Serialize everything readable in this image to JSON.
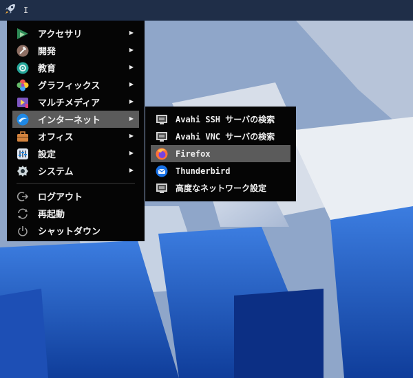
{
  "panel": {
    "launcher_icon": "rocket-icon",
    "text": "I"
  },
  "menu": {
    "items": [
      {
        "label": "アクセサリ",
        "icon": "accessories-icon",
        "has_submenu": true
      },
      {
        "label": "開発",
        "icon": "development-icon",
        "has_submenu": true
      },
      {
        "label": "教育",
        "icon": "education-icon",
        "has_submenu": true
      },
      {
        "label": "グラフィックス",
        "icon": "graphics-icon",
        "has_submenu": true
      },
      {
        "label": "マルチメディア",
        "icon": "multimedia-icon",
        "has_submenu": true
      },
      {
        "label": "インターネット",
        "icon": "internet-icon",
        "has_submenu": true,
        "active": true
      },
      {
        "label": "オフィス",
        "icon": "office-icon",
        "has_submenu": true
      },
      {
        "label": "設定",
        "icon": "settings-icon",
        "has_submenu": true
      },
      {
        "label": "システム",
        "icon": "system-icon",
        "has_submenu": true
      }
    ],
    "session": [
      {
        "label": "ログアウト",
        "icon": "logout-icon"
      },
      {
        "label": "再起動",
        "icon": "restart-icon"
      },
      {
        "label": "シャットダウン",
        "icon": "shutdown-icon"
      }
    ]
  },
  "submenu": {
    "items": [
      {
        "label": "Avahi SSH サーバの検索",
        "icon": "network-icon"
      },
      {
        "label": "Avahi VNC サーバの検索",
        "icon": "network-icon"
      },
      {
        "label": "Firefox",
        "icon": "firefox-icon",
        "active": true
      },
      {
        "label": "Thunderbird",
        "icon": "thunderbird-icon"
      },
      {
        "label": "高度なネットワーク設定",
        "icon": "network-icon"
      }
    ]
  },
  "colors": {
    "panel": "#1f2e48",
    "menu_bg": "#050505",
    "highlight": "#5b5b5b"
  }
}
